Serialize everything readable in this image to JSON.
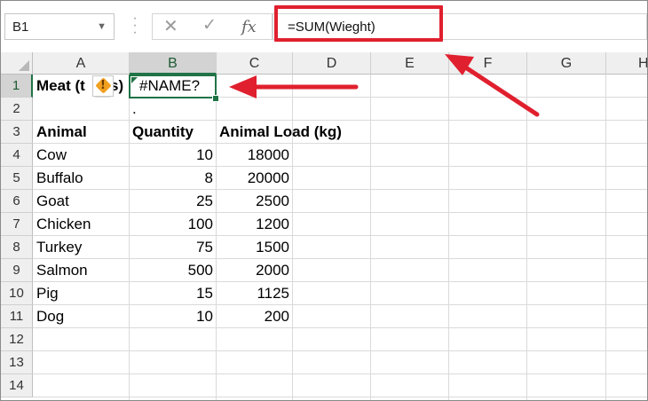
{
  "name_box": {
    "value": "B1"
  },
  "formula_bar": {
    "cancel_symbol": "✕",
    "enter_symbol": "✓",
    "fx_label": "fx",
    "formula": "=SUM(Wieght)"
  },
  "columns": [
    "A",
    "B",
    "C",
    "D",
    "E",
    "F",
    "G",
    "H"
  ],
  "rows": [
    "1",
    "2",
    "3",
    "4",
    "5",
    "6",
    "7",
    "8",
    "9",
    "10",
    "11",
    "12",
    "13",
    "14"
  ],
  "cells": {
    "a1": "Meat (t",
    "a1_tail": "s)",
    "b1": "#NAME?",
    "b2": ".",
    "header": {
      "animal": "Animal",
      "quantity": "Quantity",
      "load": "Animal Load (kg)"
    },
    "data": [
      {
        "animal": "Cow",
        "quantity": "10",
        "load": "18000"
      },
      {
        "animal": "Buffalo",
        "quantity": "8",
        "load": "20000"
      },
      {
        "animal": "Goat",
        "quantity": "25",
        "load": "2500"
      },
      {
        "animal": "Chicken",
        "quantity": "100",
        "load": "1200"
      },
      {
        "animal": "Turkey",
        "quantity": "75",
        "load": "1500"
      },
      {
        "animal": "Salmon",
        "quantity": "500",
        "load": "2000"
      },
      {
        "animal": "Pig",
        "quantity": "15",
        "load": "1125"
      },
      {
        "animal": "Dog",
        "quantity": "10",
        "load": "200"
      }
    ]
  },
  "error_indicator": {
    "symbol": "!"
  },
  "colors": {
    "accent_green": "#217346",
    "annotation_red": "#e0202e",
    "warning_orange": "#f0a020"
  }
}
